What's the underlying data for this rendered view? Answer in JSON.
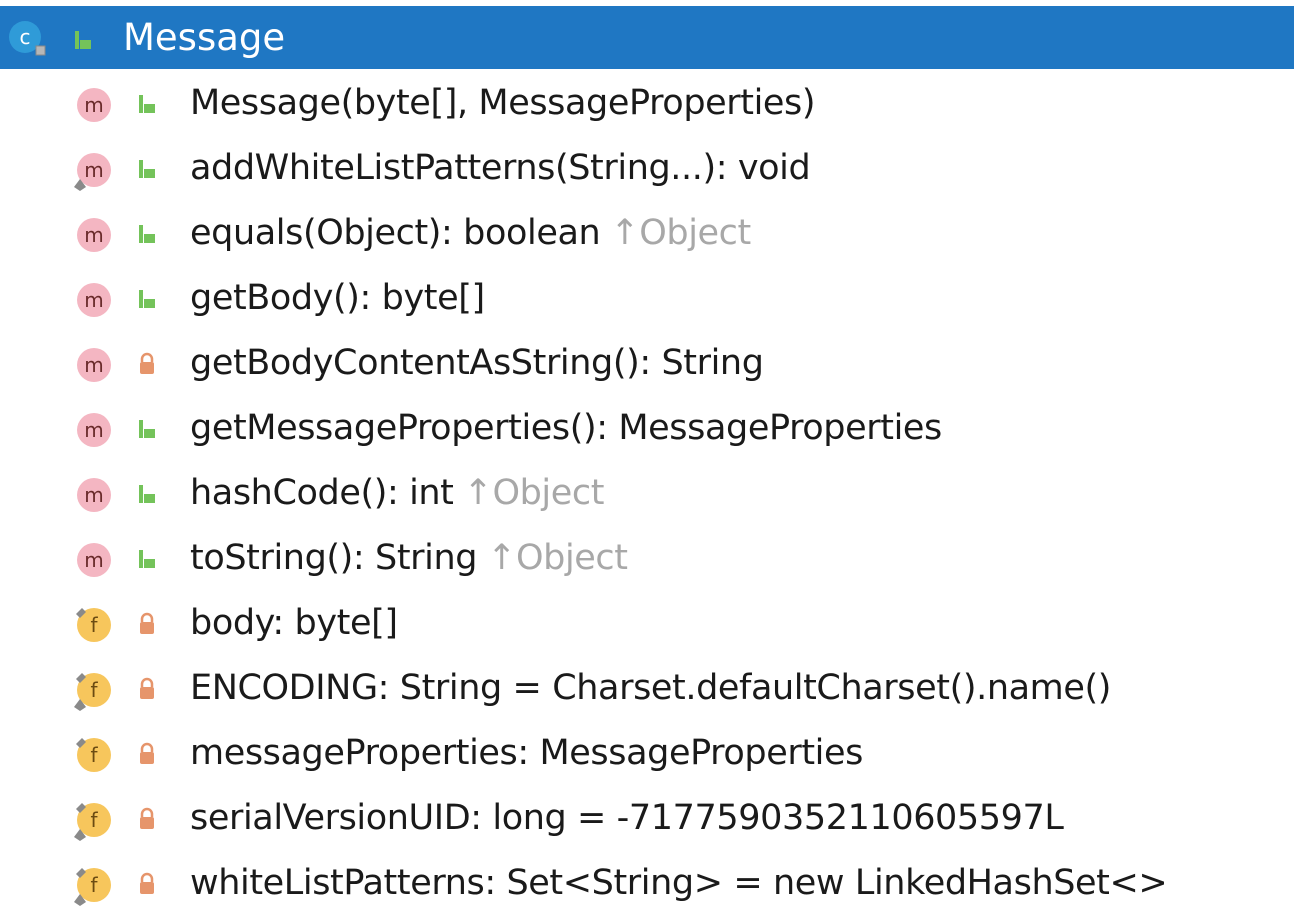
{
  "header": {
    "title": "Message",
    "icons": [
      "class-icon",
      "public-visibility-icon"
    ],
    "color": "#1f77c3"
  },
  "members": [
    {
      "kind": "method",
      "visibility": "public",
      "overridable": false,
      "text": "Message(byte[], MessageProperties)",
      "inherited": ""
    },
    {
      "kind": "method",
      "visibility": "public",
      "overridable": true,
      "text": "addWhiteListPatterns(String...): void",
      "inherited": ""
    },
    {
      "kind": "method",
      "visibility": "public",
      "overridable": false,
      "text": "equals(Object): boolean",
      "inherited": "↑Object"
    },
    {
      "kind": "method",
      "visibility": "public",
      "overridable": false,
      "text": "getBody(): byte[]",
      "inherited": ""
    },
    {
      "kind": "method",
      "visibility": "private",
      "overridable": false,
      "text": "getBodyContentAsString(): String",
      "inherited": ""
    },
    {
      "kind": "method",
      "visibility": "public",
      "overridable": false,
      "text": "getMessageProperties(): MessageProperties",
      "inherited": ""
    },
    {
      "kind": "method",
      "visibility": "public",
      "overridable": false,
      "text": "hashCode(): int",
      "inherited": "↑Object"
    },
    {
      "kind": "method",
      "visibility": "public",
      "overridable": false,
      "text": "toString(): String",
      "inherited": "↑Object"
    },
    {
      "kind": "field",
      "visibility": "private",
      "static": false,
      "text": "body: byte[]",
      "inherited": ""
    },
    {
      "kind": "field",
      "visibility": "private",
      "static": true,
      "text": "ENCODING: String = Charset.defaultCharset().name()",
      "inherited": ""
    },
    {
      "kind": "field",
      "visibility": "private",
      "static": false,
      "text": "messageProperties: MessageProperties",
      "inherited": ""
    },
    {
      "kind": "field",
      "visibility": "private",
      "static": true,
      "text": "serialVersionUID: long = -7177590352110605597L",
      "inherited": ""
    },
    {
      "kind": "field",
      "visibility": "private",
      "static": true,
      "text": "whiteListPatterns: Set<String> = new LinkedHashSet<>",
      "inherited": ""
    }
  ],
  "colors": {
    "selection": "#1f77c3",
    "method_icon": "#f4b6c2",
    "field_icon": "#f7c65c",
    "public_icon": "#5fae3c",
    "private_icon": "#e6956b",
    "inherited_text": "#a8a8a8"
  }
}
